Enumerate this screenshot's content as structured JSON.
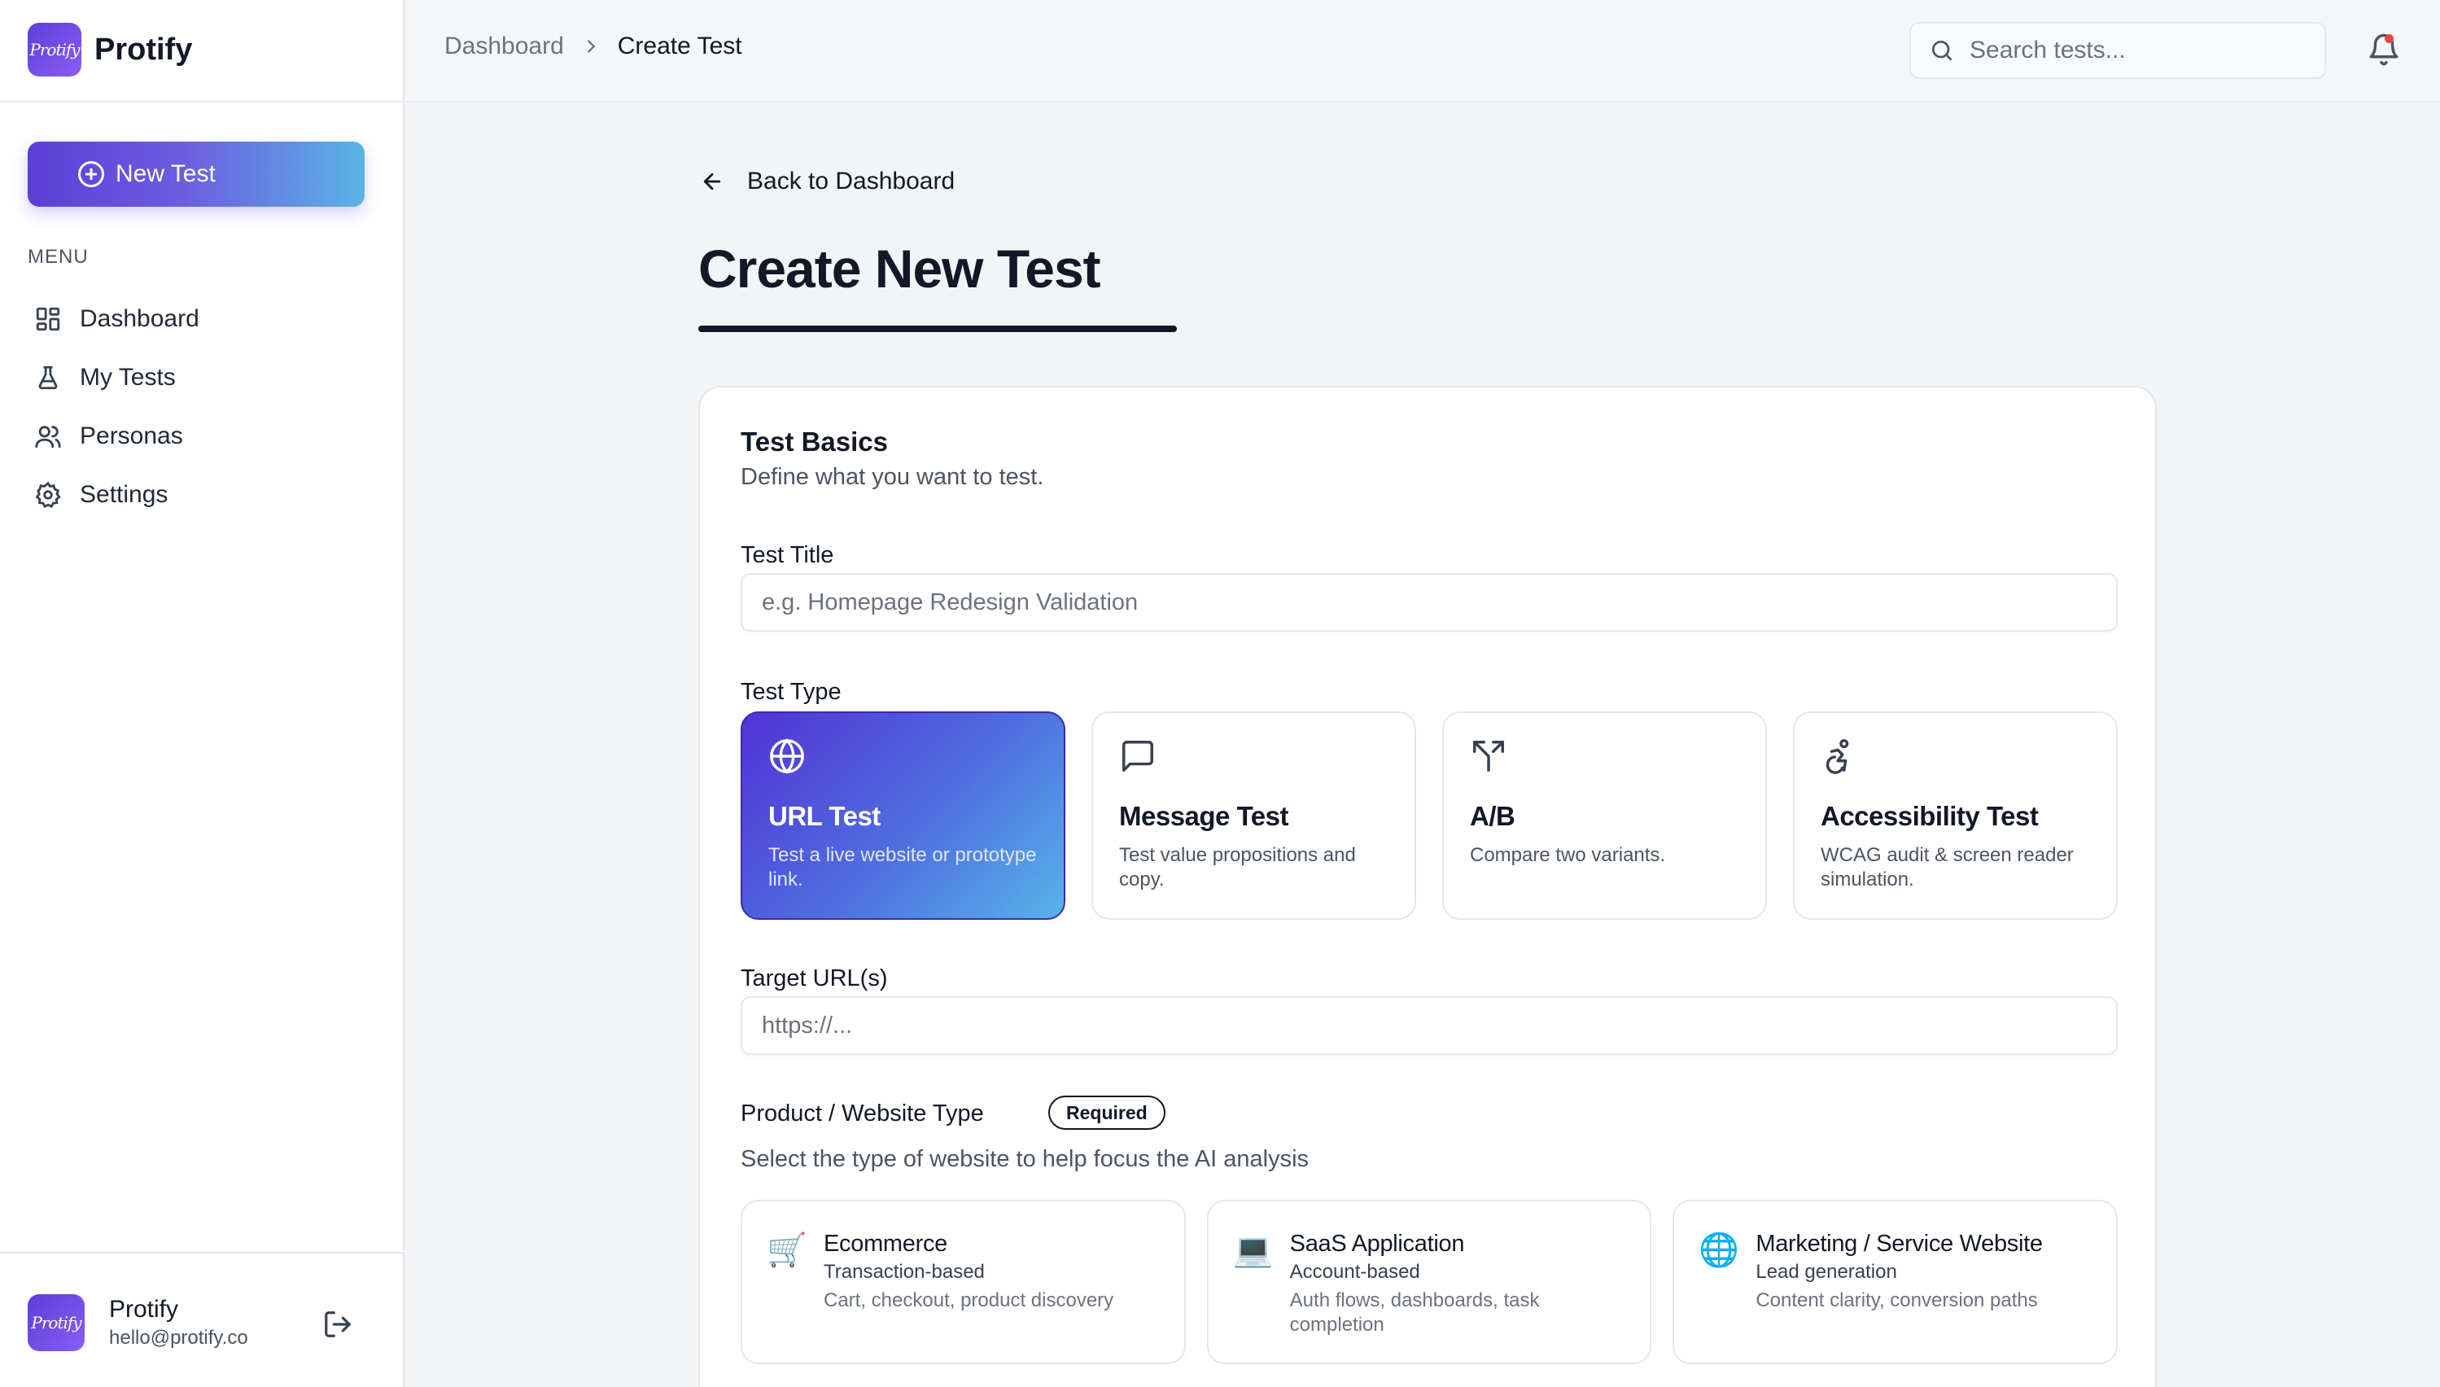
{
  "brand": {
    "name": "Protify",
    "logo_text": "Protify"
  },
  "sidebar": {
    "new_test_label": "New Test",
    "menu_label": "MENU",
    "items": [
      {
        "label": "Dashboard",
        "icon": "dashboard-grid-icon"
      },
      {
        "label": "My Tests",
        "icon": "flask-icon"
      },
      {
        "label": "Personas",
        "icon": "users-icon"
      },
      {
        "label": "Settings",
        "icon": "gear-icon"
      }
    ],
    "profile": {
      "name": "Protify",
      "email": "hello@protify.co"
    }
  },
  "header": {
    "breadcrumb": [
      "Dashboard",
      "Create Test"
    ],
    "search_placeholder": "Search tests..."
  },
  "main": {
    "back_label": "Back to Dashboard",
    "page_title": "Create New Test",
    "card": {
      "title": "Test Basics",
      "subtitle": "Define what you want to test.",
      "test_title_label": "Test Title",
      "test_title_placeholder": "e.g. Homepage Redesign Validation",
      "test_type_label": "Test Type",
      "test_types": [
        {
          "title": "URL Test",
          "desc": "Test a live website or prototype link.",
          "icon": "globe-icon",
          "selected": true
        },
        {
          "title": "Message Test",
          "desc": "Test value propositions and copy.",
          "icon": "message-square-icon",
          "selected": false
        },
        {
          "title": "A/B",
          "desc": "Compare two variants.",
          "icon": "split-arrows-icon",
          "selected": false
        },
        {
          "title": "Accessibility Test",
          "desc": "WCAG audit & screen reader simulation.",
          "icon": "accessibility-icon",
          "selected": false
        }
      ],
      "target_url_label": "Target URL(s)",
      "target_url_placeholder": "https://...",
      "product_type_label": "Product / Website Type",
      "required_badge": "Required",
      "product_type_help": "Select the type of website to help focus the AI analysis",
      "product_types": [
        {
          "title": "Ecommerce",
          "sub": "Transaction-based",
          "desc": "Cart, checkout, product discovery",
          "icon": "shopping-cart-icon"
        },
        {
          "title": "SaaS Application",
          "sub": "Account-based",
          "desc": "Auth flows, dashboards, task completion",
          "icon": "laptop-icon"
        },
        {
          "title": "Marketing / Service Website",
          "sub": "Lead generation",
          "desc": "Content clarity, conversion paths",
          "icon": "globe-emoji-icon"
        }
      ]
    }
  },
  "colors": {
    "accent": "#5b3fd8",
    "accent_light": "#57b3e8",
    "notification": "#ef4444"
  }
}
